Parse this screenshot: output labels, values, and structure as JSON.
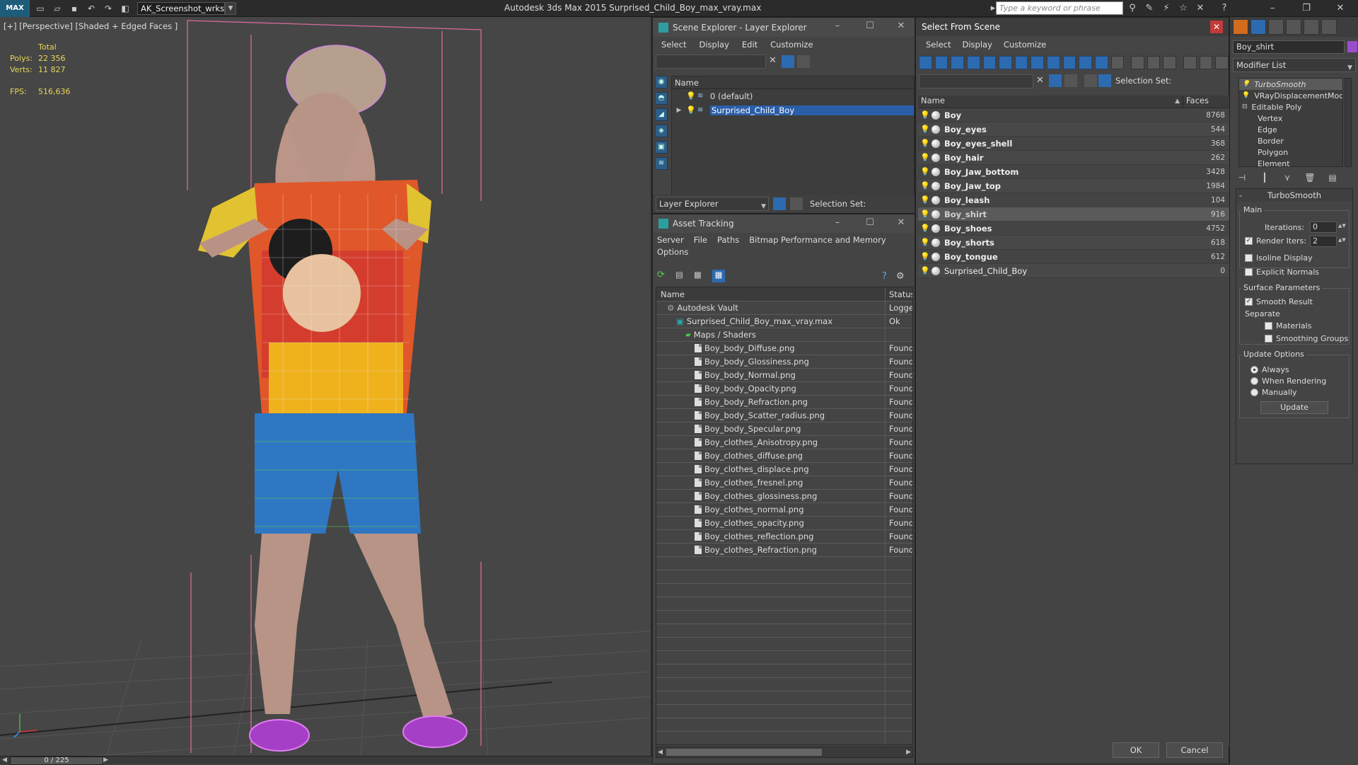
{
  "titlebar": {
    "logo": "MAX",
    "workspace": "AK_Screenshot_wrksp",
    "title": "Autodesk 3ds Max  2015    Surprised_Child_Boy_max_vray.max",
    "search_placeholder": "Type a keyword or phrase"
  },
  "viewport": {
    "label": "[+] [Perspective] [Shaded + Edged Faces ]",
    "stats": {
      "total_label": "Total",
      "polys_label": "Polys:",
      "polys_value": "22 356",
      "verts_label": "Verts:",
      "verts_value": "11 827",
      "fps_label": "FPS:",
      "fps_value": "516,636"
    }
  },
  "timeline": {
    "frame": "0 / 225"
  },
  "scene_explorer": {
    "title": "Scene Explorer - Layer Explorer",
    "menu": [
      "Select",
      "Display",
      "Edit",
      "Customize"
    ],
    "column_name": "Name",
    "layers": [
      {
        "name": "0 (default)",
        "selected": false
      },
      {
        "name": "Surprised_Child_Boy",
        "selected": true
      }
    ],
    "explorer_dropdown": "Layer Explorer",
    "selection_set_label": "Selection Set:"
  },
  "asset_tracking": {
    "title": "Asset Tracking",
    "menu": [
      "Server",
      "File",
      "Paths",
      "Bitmap Performance and Memory"
    ],
    "menu2": "Options",
    "col_name": "Name",
    "col_status": "Status",
    "rows": [
      {
        "name": "Autodesk Vault",
        "status": "Logged",
        "indent": 1,
        "type": "vault"
      },
      {
        "name": "Surprised_Child_Boy_max_vray.max",
        "status": "Ok",
        "indent": 2,
        "type": "max"
      },
      {
        "name": "Maps / Shaders",
        "status": "",
        "indent": 3,
        "type": "folder"
      },
      {
        "name": "Boy_body_Diffuse.png",
        "status": "Found",
        "indent": 4,
        "type": "file"
      },
      {
        "name": "Boy_body_Glossiness.png",
        "status": "Found",
        "indent": 4,
        "type": "file"
      },
      {
        "name": "Boy_body_Normal.png",
        "status": "Found",
        "indent": 4,
        "type": "file"
      },
      {
        "name": "Boy_body_Opacity.png",
        "status": "Found",
        "indent": 4,
        "type": "file"
      },
      {
        "name": "Boy_body_Refraction.png",
        "status": "Found",
        "indent": 4,
        "type": "file"
      },
      {
        "name": "Boy_body_Scatter_radius.png",
        "status": "Found",
        "indent": 4,
        "type": "file"
      },
      {
        "name": "Boy_body_Specular.png",
        "status": "Found",
        "indent": 4,
        "type": "file"
      },
      {
        "name": "Boy_clothes_Anisotropy.png",
        "status": "Found",
        "indent": 4,
        "type": "file"
      },
      {
        "name": "Boy_clothes_diffuse.png",
        "status": "Found",
        "indent": 4,
        "type": "file"
      },
      {
        "name": "Boy_clothes_displace.png",
        "status": "Found",
        "indent": 4,
        "type": "file"
      },
      {
        "name": "Boy_clothes_fresnel.png",
        "status": "Found",
        "indent": 4,
        "type": "file"
      },
      {
        "name": "Boy_clothes_glossiness.png",
        "status": "Found",
        "indent": 4,
        "type": "file"
      },
      {
        "name": "Boy_clothes_normal.png",
        "status": "Found",
        "indent": 4,
        "type": "file"
      },
      {
        "name": "Boy_clothes_opacity.png",
        "status": "Found",
        "indent": 4,
        "type": "file"
      },
      {
        "name": "Boy_clothes_reflection.png",
        "status": "Found",
        "indent": 4,
        "type": "file"
      },
      {
        "name": "Boy_clothes_Refraction.png",
        "status": "Found",
        "indent": 4,
        "type": "file"
      }
    ]
  },
  "select_from_scene": {
    "title": "Select From Scene",
    "menu": [
      "Select",
      "Display",
      "Customize"
    ],
    "selection_set_label": "Selection Set:",
    "col_name": "Name",
    "col_faces": "Faces",
    "objects": [
      {
        "name": "Boy",
        "faces": "8768",
        "bold": true,
        "selected": false
      },
      {
        "name": "Boy_eyes",
        "faces": "544",
        "bold": true,
        "selected": false
      },
      {
        "name": "Boy_eyes_shell",
        "faces": "368",
        "bold": true,
        "selected": false
      },
      {
        "name": "Boy_hair",
        "faces": "262",
        "bold": true,
        "selected": false
      },
      {
        "name": "Boy_Jaw_bottom",
        "faces": "3428",
        "bold": true,
        "selected": false
      },
      {
        "name": "Boy_Jaw_top",
        "faces": "1984",
        "bold": true,
        "selected": false
      },
      {
        "name": "Boy_leash",
        "faces": "104",
        "bold": true,
        "selected": false
      },
      {
        "name": "Boy_shirt",
        "faces": "916",
        "bold": true,
        "selected": true
      },
      {
        "name": "Boy_shoes",
        "faces": "4752",
        "bold": true,
        "selected": false
      },
      {
        "name": "Boy_shorts",
        "faces": "618",
        "bold": true,
        "selected": false
      },
      {
        "name": "Boy_tongue",
        "faces": "612",
        "bold": true,
        "selected": false
      },
      {
        "name": "Surprised_Child_Boy",
        "faces": "0",
        "bold": false,
        "selected": false
      }
    ],
    "ok": "OK",
    "cancel": "Cancel"
  },
  "command_panel": {
    "object_name": "Boy_shirt",
    "object_color": "#9b4dca",
    "modifier_list": "Modifier List",
    "stack": [
      {
        "label": "TurboSmooth",
        "active": true,
        "indent": 0
      },
      {
        "label": "VRayDisplacementMod",
        "active": false,
        "indent": 0
      },
      {
        "label": "Editable Poly",
        "active": false,
        "indent": 0
      },
      {
        "label": "Vertex",
        "active": false,
        "indent": 1
      },
      {
        "label": "Edge",
        "active": false,
        "indent": 1
      },
      {
        "label": "Border",
        "active": false,
        "indent": 1
      },
      {
        "label": "Polygon",
        "active": false,
        "indent": 1
      },
      {
        "label": "Element",
        "active": false,
        "indent": 1
      }
    ],
    "rollout_title": "TurboSmooth",
    "main_group": "Main",
    "iterations_label": "Iterations:",
    "iterations_value": "0",
    "render_iters_label": "Render Iters:",
    "render_iters_value": "2",
    "render_iters_checked": true,
    "isoline_label": "Isoline Display",
    "isoline_checked": false,
    "explicit_label": "Explicit Normals",
    "explicit_checked": false,
    "surface_group": "Surface Parameters",
    "smooth_label": "Smooth Result",
    "smooth_checked": true,
    "separate_label": "Separate",
    "materials_label": "Materials",
    "materials_checked": false,
    "smoothing_label": "Smoothing Groups",
    "smoothing_checked": false,
    "update_group": "Update Options",
    "update_options": [
      "Always",
      "When Rendering",
      "Manually"
    ],
    "update_selected": "Always",
    "update_button": "Update"
  }
}
